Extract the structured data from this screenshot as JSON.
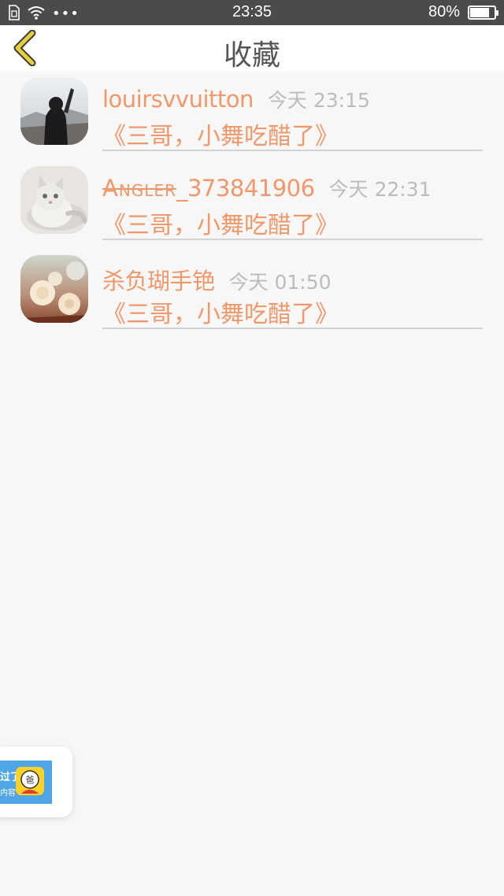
{
  "status_bar": {
    "time": "23:35",
    "battery_text": "80%",
    "battery_level": 0.8,
    "icons": [
      "sim-card-icon",
      "wifi-icon",
      "more-dots-icon",
      "battery-icon"
    ]
  },
  "nav": {
    "title": "收藏",
    "back_icon": "chevron-left-icon",
    "back_color": "#e6cf3a"
  },
  "favorites": [
    {
      "username": "louirsvvuitton",
      "time": "今天 23:15",
      "title": "《三哥，小舞吃醋了》",
      "avatar": "girl-landscape-avatar"
    },
    {
      "username_strike": "Angler",
      "username_rest": "_373841906",
      "time": "今天 22:31",
      "title": "《三哥，小舞吃醋了》",
      "avatar": "cat-avatar"
    },
    {
      "username": "杀负瑚手铯",
      "time": "今天 01:50",
      "title": "《三哥，小舞吃醋了》",
      "avatar": "flowers-avatar"
    }
  ],
  "floating_ad": {
    "line1": "过了",
    "line2": "内容",
    "icon": "mascot-icon"
  },
  "colors": {
    "accent": "#f0986a",
    "muted": "#bcbcbc",
    "status_bar_bg": "#4b4b4b",
    "page_bg": "#f7f7f7",
    "divider": "#d2d2d2"
  }
}
